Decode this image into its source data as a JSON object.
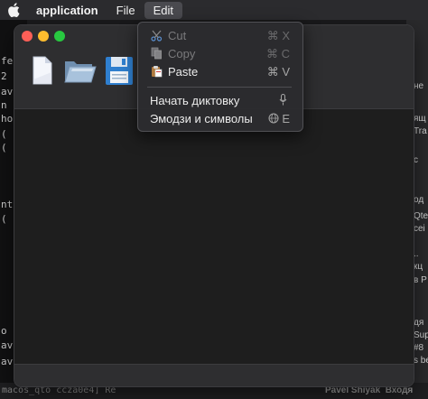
{
  "menubar": {
    "app_name": "application",
    "file_label": "File",
    "edit_label": "Edit"
  },
  "edit_menu": {
    "items": [
      {
        "label": "Cut",
        "shortcut": "⌘ X",
        "icon": "scissors-icon",
        "enabled": false
      },
      {
        "label": "Copy",
        "shortcut": "⌘ C",
        "icon": "copy-icon",
        "enabled": false
      },
      {
        "label": "Paste",
        "shortcut": "⌘ V",
        "icon": "paste-icon",
        "enabled": true
      },
      {
        "label": "Начать диктовку",
        "shortcut": "🎙",
        "icon": "microphone-icon",
        "enabled": true
      },
      {
        "label": "Эмодзи и символы",
        "shortcut": "🌐 E",
        "icon": "globe-icon",
        "enabled": true
      }
    ]
  },
  "toolbar": {
    "buttons": [
      "new-document-icon",
      "open-folder-icon",
      "save-floppy-icon"
    ]
  },
  "background_terminal": {
    "lines": [
      "fe",
      "2",
      "av",
      "n",
      "ho",
      "(",
      "(",
      "nt",
      "(",
      "o",
      "av",
      "av",
      "macos_qto ccza0e4] Re"
    ]
  },
  "background_chat": {
    "lines": [
      "не",
      "ящ",
      "Tra",
      "с",
      "од",
      "Qte",
      "cei",
      "..",
      "кц",
      "в Р",
      "дя",
      "Sup",
      "#8",
      "s be"
    ]
  },
  "bottom_strip": {
    "left_text": "macos_qto ccza0e4] Re",
    "right_text": "Pavel Shiyak  Входя"
  },
  "colors": {
    "close": "#fe5f57",
    "minimize": "#febc2e",
    "maximize": "#28c840",
    "menu_bg": "#2b2b2e"
  }
}
